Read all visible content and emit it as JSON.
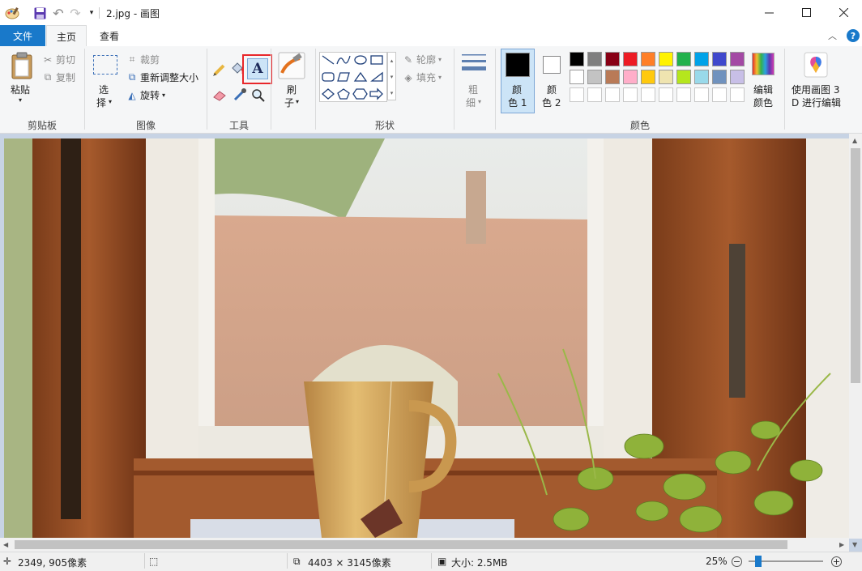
{
  "window": {
    "title": "2.jpg - 画图",
    "quick_access": [
      "paint-app-icon",
      "save-icon",
      "undo-icon",
      "redo-icon",
      "customize-dropdown-icon"
    ]
  },
  "tabs": [
    {
      "label": "文件",
      "active": false
    },
    {
      "label": "主页",
      "active": true
    },
    {
      "label": "查看",
      "active": false
    }
  ],
  "ribbon": {
    "clipboard": {
      "label": "剪贴板",
      "paste": "粘贴",
      "cut": "剪切",
      "copy": "复制"
    },
    "image": {
      "label": "图像",
      "select_1": "选",
      "select_2": "择",
      "crop": "裁剪",
      "resize": "重新调整大小",
      "rotate": "旋转"
    },
    "tools": {
      "label": "工具",
      "highlighted_tool": "text-tool",
      "text_glyph": "A"
    },
    "brushes": {
      "label_1": "刷",
      "label_2": "子"
    },
    "shapes": {
      "label": "形状",
      "outline": "轮廓",
      "fill": "填充"
    },
    "size": {
      "label_1": "粗",
      "label_2": "细"
    },
    "colors": {
      "label": "颜色",
      "color1_1": "颜",
      "color1_2": "色 1",
      "color2_1": "颜",
      "color2_2": "色 2",
      "color1_value": "#000000",
      "color2_value": "#ffffff",
      "edit_1": "编辑",
      "edit_2": "颜色",
      "palette_row1": [
        "#000000",
        "#7f7f7f",
        "#880015",
        "#ed1c24",
        "#ff7f27",
        "#fff200",
        "#22b14c",
        "#00a2e8",
        "#3f48cc",
        "#a349a4"
      ],
      "palette_row2": [
        "#ffffff",
        "#c3c3c3",
        "#b97a57",
        "#ffaec9",
        "#ffc90e",
        "#efe4b0",
        "#b5e61d",
        "#99d9ea",
        "#7092be",
        "#c8bfe7"
      ]
    },
    "paint3d": {
      "label_1": "使用画图 3",
      "label_2": "D 进行编辑"
    }
  },
  "status": {
    "cursor": "2349, 905像素",
    "dimensions": "4403 × 3145像素",
    "size": "大小: 2.5MB",
    "zoom": "25%",
    "zoom_fraction": 0.13
  }
}
